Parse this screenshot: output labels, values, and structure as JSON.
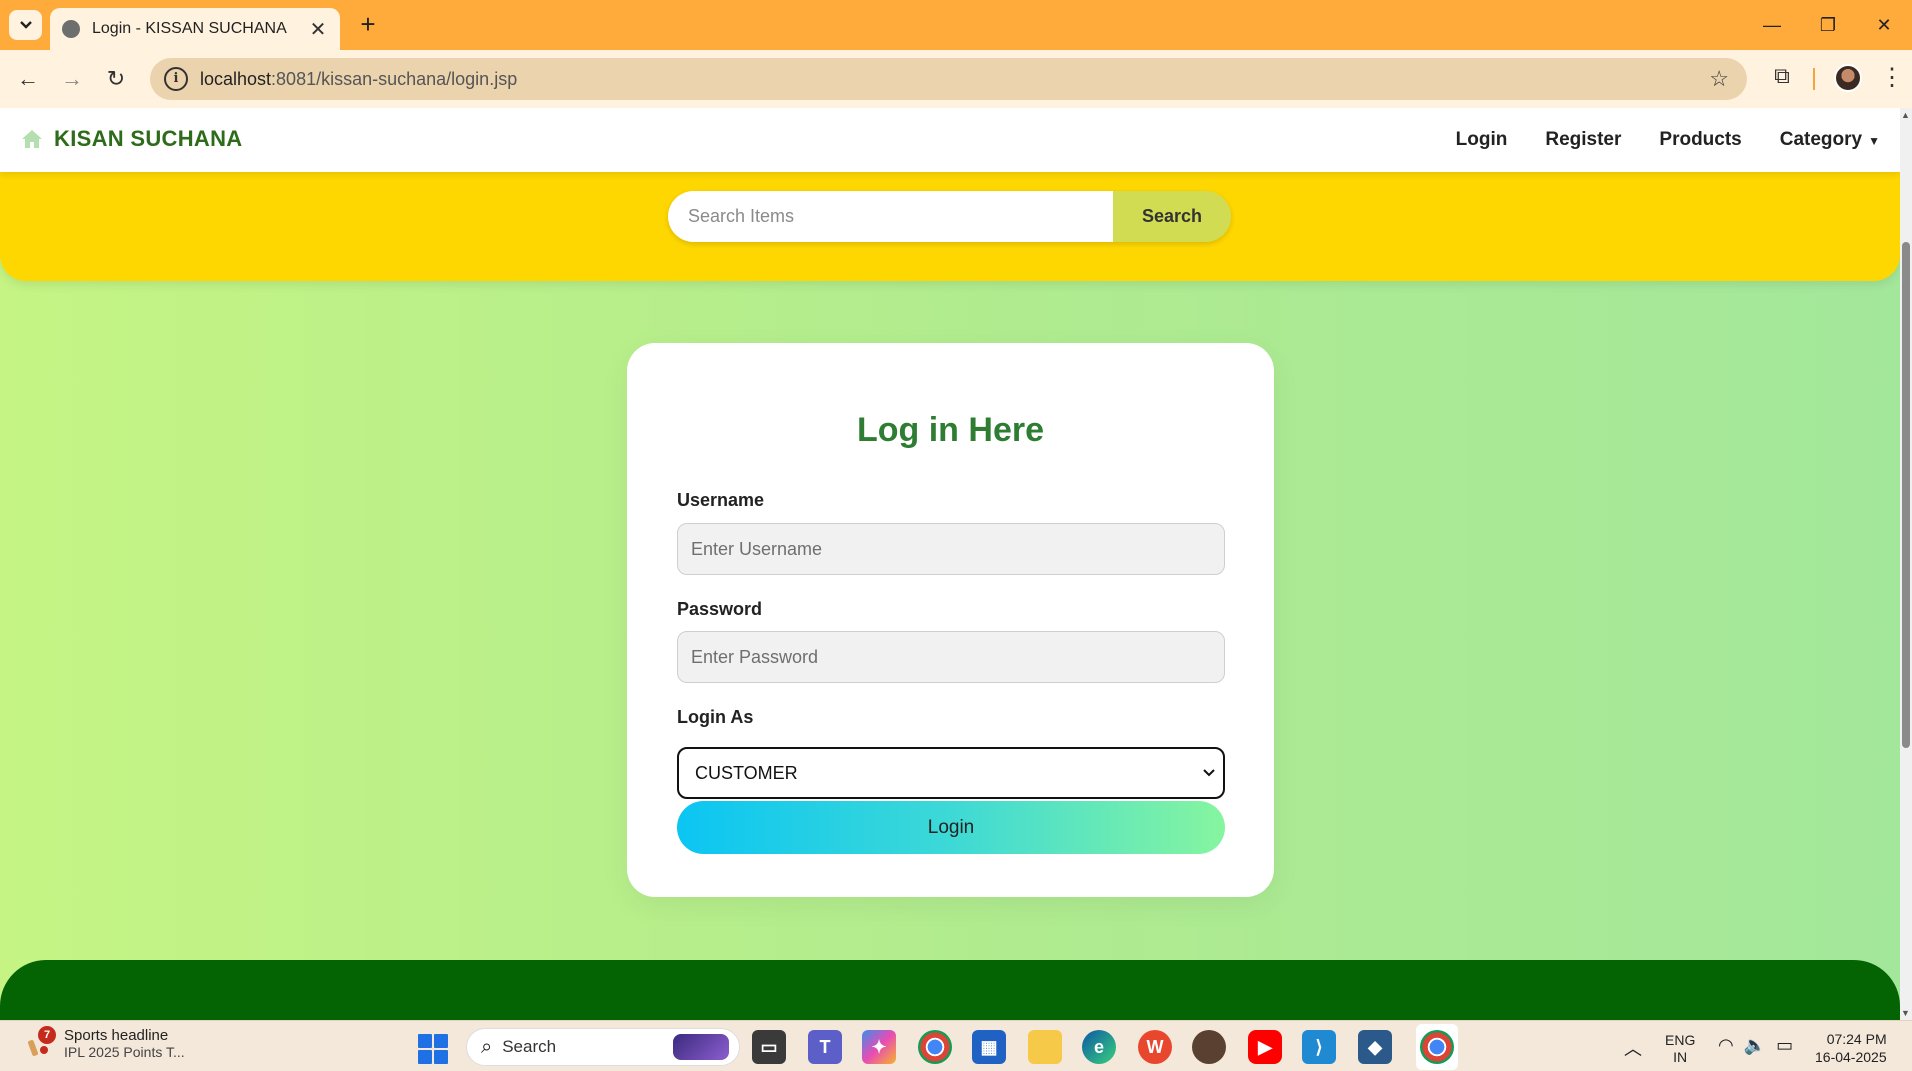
{
  "browser": {
    "tab_title": "Login - KISSAN SUCHANA",
    "url_host": "localhost",
    "url_rest": ":8081/kissan-suchana/login.jsp"
  },
  "site": {
    "brand": "KISAN SUCHANA",
    "nav": [
      "Login",
      "Register",
      "Products",
      "Category"
    ]
  },
  "search": {
    "placeholder": "Search Items",
    "button": "Search"
  },
  "login_form": {
    "title": "Log in Here",
    "username_label": "Username",
    "username_placeholder": "Enter Username",
    "password_label": "Password",
    "password_placeholder": "Enter Password",
    "login_as_label": "Login As",
    "login_as_value": "CUSTOMER",
    "submit": "Login"
  },
  "taskbar": {
    "widget_badge": "7",
    "widget_title": "Sports headline",
    "widget_sub": "IPL 2025 Points T...",
    "search": "Search",
    "lang_line1": "ENG",
    "lang_line2": "IN",
    "time": "07:24 PM",
    "date": "16-04-2025"
  },
  "colors": {
    "tabbar": "#ffab3c",
    "brand_green": "#2e6b1b",
    "title_green": "#2e7d32",
    "yellow_band": "#ffd700",
    "footer_green": "#046303"
  }
}
